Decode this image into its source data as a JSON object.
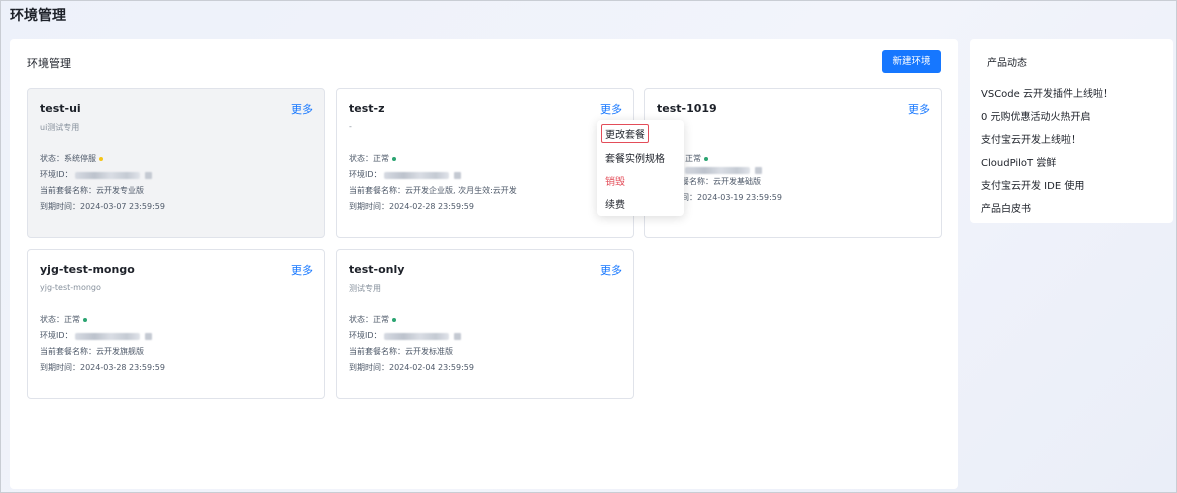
{
  "page": {
    "title": "环境管理"
  },
  "main": {
    "title": "环境管理",
    "new_env_label": "新建环境",
    "more_label": "更多"
  },
  "cards": [
    {
      "name": "test-ui",
      "desc": "ui测试专用",
      "status_label": "状态：",
      "status": "系统停服",
      "status_color": "#f5c518",
      "env_id_label": "环境ID：",
      "plan_label": "当前套餐名称：",
      "plan": "云开发专业版",
      "expire_label": "到期时间：",
      "expire": "2024-03-07 23:59:59"
    },
    {
      "name": "test-z",
      "desc": "-",
      "status_label": "状态：",
      "status": "正常",
      "status_color": "#2ba471",
      "env_id_label": "环境ID：",
      "plan_label": "当前套餐名称：",
      "plan": "云开发企业版, 次月生效:云开发",
      "expire_label": "到期时间：",
      "expire": "2024-02-28 23:59:59"
    },
    {
      "name": "test-1019",
      "desc": "",
      "status_label": "",
      "status": "正常",
      "status_color": "#2ba471",
      "env_id_label": "",
      "plan_label": "餐名称：",
      "plan": "云开发基础版",
      "expire_label": "间：",
      "expire": "2024-03-19 23:59:59"
    },
    {
      "name": "yjg-test-mongo",
      "desc": "yjg-test-mongo",
      "status_label": "状态：",
      "status": "正常",
      "status_color": "#2ba471",
      "env_id_label": "环境ID：",
      "plan_label": "当前套餐名称：",
      "plan": "云开发旗舰版",
      "expire_label": "到期时间：",
      "expire": "2024-03-28 23:59:59"
    },
    {
      "name": "test-only",
      "desc": "测试专用",
      "status_label": "状态：",
      "status": "正常",
      "status_color": "#2ba471",
      "env_id_label": "环境ID：",
      "plan_label": "当前套餐名称：",
      "plan": "云开发标准版",
      "expire_label": "到期时间：",
      "expire": "2024-02-04 23:59:59"
    }
  ],
  "dropdown": {
    "items": [
      {
        "label": "更改套餐",
        "highlighted": true
      },
      {
        "label": "套餐实例规格"
      },
      {
        "label": "销毁",
        "danger": true,
        "color": "#e34d59"
      },
      {
        "label": "续费"
      }
    ]
  },
  "side": {
    "title": "产品动态",
    "items": [
      "VSCode 云开发插件上线啦！",
      "0 元购优惠活动火热开启",
      "支付宝云开发上线啦！",
      "CloudPiloT 尝鲜",
      "支付宝云开发 IDE 使用",
      "产品白皮书"
    ]
  },
  "colors": {
    "accent": "#1677ff",
    "danger": "#e34d59",
    "ok": "#2ba471",
    "warn": "#f5c518"
  }
}
